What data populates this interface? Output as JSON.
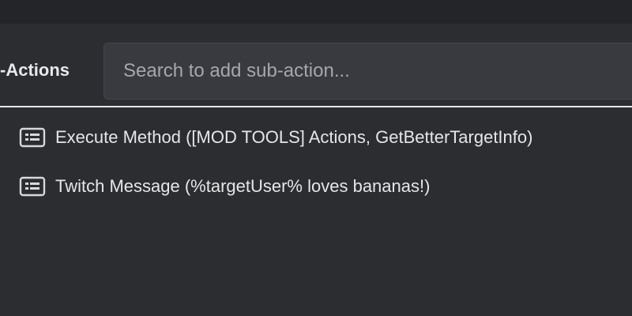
{
  "header": {
    "title": "-Actions"
  },
  "search": {
    "placeholder": "Search to add sub-action..."
  },
  "sub_actions": [
    {
      "label": "Execute Method ([MOD TOOLS] Actions, GetBetterTargetInfo)",
      "icon": "sub-action-icon"
    },
    {
      "label": "Twitch Message (%targetUser% loves bananas!)",
      "icon": "sub-action-icon"
    }
  ],
  "colors": {
    "background": "#2b2d31",
    "topbar": "#242528",
    "search_bg": "#383a40",
    "divider": "#e6e6e6",
    "text": "#e6e6e7",
    "placeholder": "#a6a7ab"
  }
}
